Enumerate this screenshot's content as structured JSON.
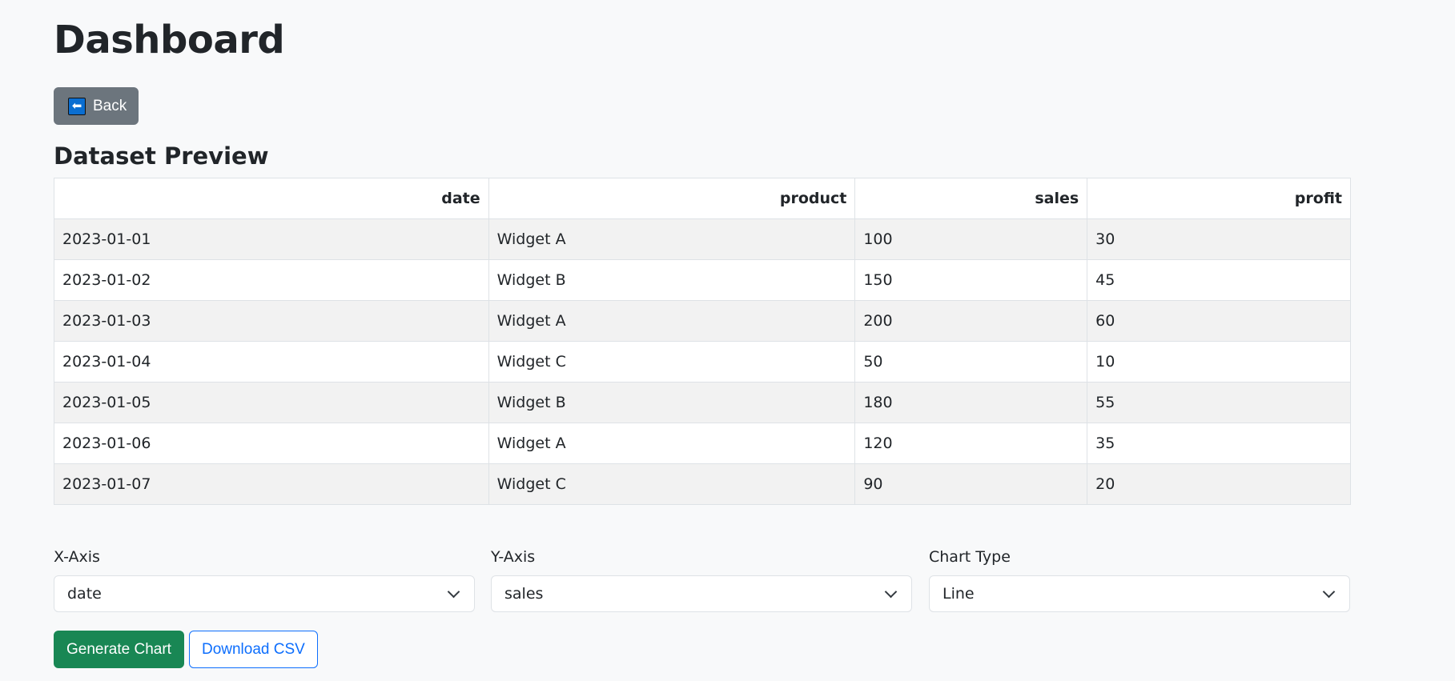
{
  "page": {
    "title": "Dashboard"
  },
  "back_button": {
    "label": "Back",
    "icon": "left-arrow-icon",
    "icon_glyph": "⬅"
  },
  "preview": {
    "title": "Dataset Preview",
    "columns": [
      "date",
      "product",
      "sales",
      "profit"
    ],
    "rows": [
      [
        "2023-01-01",
        "Widget A",
        "100",
        "30"
      ],
      [
        "2023-01-02",
        "Widget B",
        "150",
        "45"
      ],
      [
        "2023-01-03",
        "Widget A",
        "200",
        "60"
      ],
      [
        "2023-01-04",
        "Widget C",
        "50",
        "10"
      ],
      [
        "2023-01-05",
        "Widget B",
        "180",
        "55"
      ],
      [
        "2023-01-06",
        "Widget A",
        "120",
        "35"
      ],
      [
        "2023-01-07",
        "Widget C",
        "90",
        "20"
      ]
    ]
  },
  "controls": {
    "x_axis": {
      "label": "X-Axis",
      "value": "date"
    },
    "y_axis": {
      "label": "Y-Axis",
      "value": "sales"
    },
    "chart_type": {
      "label": "Chart Type",
      "value": "Line"
    }
  },
  "actions": {
    "generate_label": "Generate Chart",
    "download_label": "Download CSV"
  },
  "colors": {
    "success": "#198754",
    "primary": "#0d6efd",
    "secondary": "#6c757d",
    "background": "#f8f9fa"
  }
}
